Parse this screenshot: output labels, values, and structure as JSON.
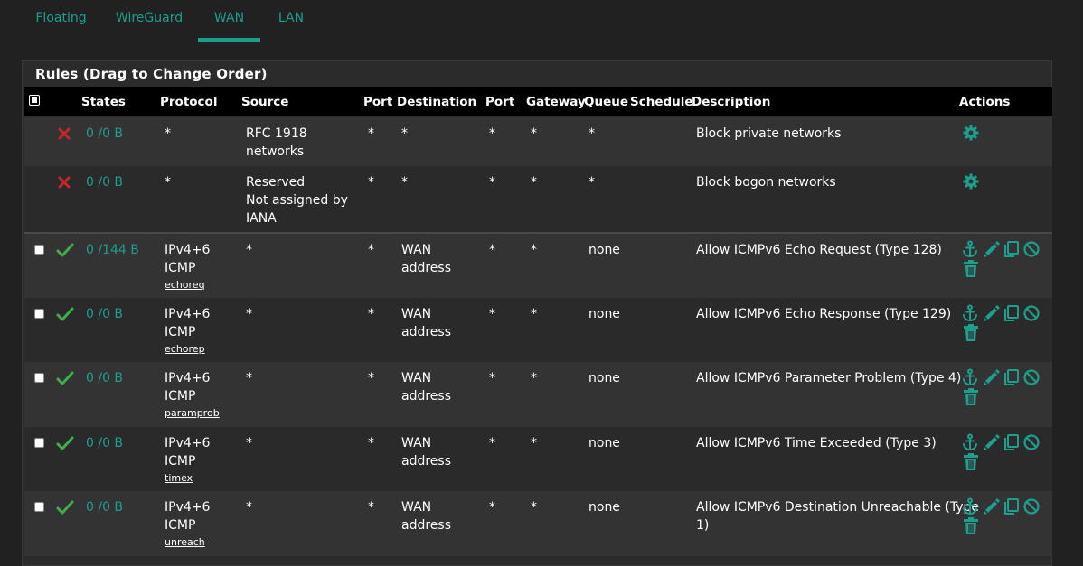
{
  "tabs": [
    {
      "label": "Floating"
    },
    {
      "label": "WireGuard"
    },
    {
      "label": "WAN",
      "active": true
    },
    {
      "label": "LAN"
    }
  ],
  "panel": {
    "title": "Rules (Drag to Change Order)"
  },
  "columns": {
    "states": "States",
    "protocol": "Protocol",
    "source": "Source",
    "port1": "Port",
    "destination": "Destination",
    "port2": "Port",
    "gateway": "Gateway",
    "queue": "Queue",
    "schedule": "Schedule",
    "description": "Description",
    "actions": "Actions"
  },
  "colors": {
    "accent": "#1e9e8c",
    "pass": "#3fae49",
    "block": "#c62828"
  },
  "rows": [
    {
      "status": "block",
      "states": "0 /0 B",
      "protocol": "*",
      "protocol_alias": "",
      "source": "RFC 1918\nnetworks",
      "port1": "*",
      "destination": "*",
      "port2": "*",
      "gateway": "*",
      "queue": "*",
      "schedule": "",
      "description": "Block private networks",
      "fixed": true
    },
    {
      "status": "block",
      "states": "0 /0 B",
      "protocol": "*",
      "protocol_alias": "",
      "source": "Reserved\nNot assigned by\nIANA",
      "port1": "*",
      "destination": "*",
      "port2": "*",
      "gateway": "*",
      "queue": "*",
      "schedule": "",
      "description": "Block bogon networks",
      "fixed": true
    },
    {
      "status": "pass",
      "states": "0 /144 B",
      "protocol": "IPv4+6\nICMP",
      "protocol_alias": "echoreq",
      "source": "*",
      "port1": "*",
      "destination": "WAN\naddress",
      "port2": "*",
      "gateway": "*",
      "queue": "none",
      "schedule": "",
      "description": "Allow ICMPv6 Echo Request (Type 128)",
      "fixed": false
    },
    {
      "status": "pass",
      "states": "0 /0 B",
      "protocol": "IPv4+6\nICMP",
      "protocol_alias": "echorep",
      "source": "*",
      "port1": "*",
      "destination": "WAN\naddress",
      "port2": "*",
      "gateway": "*",
      "queue": "none",
      "schedule": "",
      "description": "Allow ICMPv6 Echo Response (Type 129)",
      "fixed": false
    },
    {
      "status": "pass",
      "states": "0 /0 B",
      "protocol": "IPv4+6\nICMP",
      "protocol_alias": "paramprob",
      "source": "*",
      "port1": "*",
      "destination": "WAN\naddress",
      "port2": "*",
      "gateway": "*",
      "queue": "none",
      "schedule": "",
      "description": "Allow ICMPv6 Parameter Problem (Type 4)",
      "fixed": false
    },
    {
      "status": "pass",
      "states": "0 /0 B",
      "protocol": "IPv4+6\nICMP",
      "protocol_alias": "timex",
      "source": "*",
      "port1": "*",
      "destination": "WAN\naddress",
      "port2": "*",
      "gateway": "*",
      "queue": "none",
      "schedule": "",
      "description": "Allow ICMPv6 Time Exceeded (Type 3)",
      "fixed": false
    },
    {
      "status": "pass",
      "states": "0 /0 B",
      "protocol": "IPv4+6\nICMP",
      "protocol_alias": "unreach",
      "source": "*",
      "port1": "*",
      "destination": "WAN\naddress",
      "port2": "*",
      "gateway": "*",
      "queue": "none",
      "schedule": "",
      "description": "Allow ICMPv6 Destination Unreachable (Type\n1)",
      "fixed": false
    }
  ]
}
